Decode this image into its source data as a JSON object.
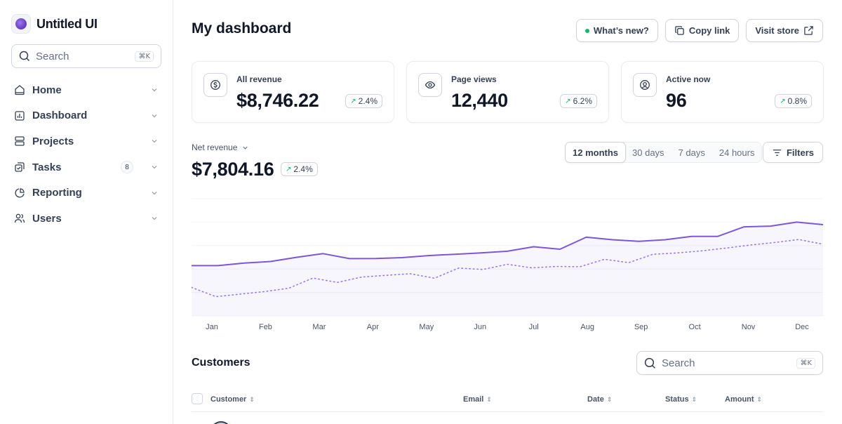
{
  "brand": {
    "name": "Untitled UI"
  },
  "sidebar": {
    "search": {
      "placeholder": "Search",
      "shortcut": "⌘K"
    },
    "items": [
      {
        "label": "Home",
        "icon": "home-icon"
      },
      {
        "label": "Dashboard",
        "icon": "bar-chart-icon"
      },
      {
        "label": "Projects",
        "icon": "layers-icon"
      },
      {
        "label": "Tasks",
        "icon": "check-square-icon",
        "badge": "8"
      },
      {
        "label": "Reporting",
        "icon": "pie-chart-icon"
      },
      {
        "label": "Users",
        "icon": "users-icon"
      }
    ]
  },
  "header": {
    "title": "My dashboard",
    "whats_new": "What’s new?",
    "copy_link": "Copy link",
    "visit_store": "Visit store"
  },
  "stats": [
    {
      "label": "All revenue",
      "value": "$8,746.22",
      "trend": "2.4%",
      "icon": "dollar-circle-icon"
    },
    {
      "label": "Page views",
      "value": "12,440",
      "trend": "6.2%",
      "icon": "eye-icon"
    },
    {
      "label": "Active now",
      "value": "96",
      "trend": "0.8%",
      "icon": "user-circle-icon"
    }
  ],
  "net_revenue": {
    "label": "Net revenue",
    "value": "$7,804.16",
    "trend": "2.4%"
  },
  "time_ranges": [
    "12 months",
    "30 days",
    "7 days",
    "24 hours"
  ],
  "selected_range": "12 months",
  "filters_label": "Filters",
  "chart_data": {
    "type": "line",
    "categories": [
      "Jan",
      "Feb",
      "Mar",
      "Apr",
      "May",
      "Jun",
      "Jul",
      "Aug",
      "Sep",
      "Oct",
      "Nov",
      "Dec"
    ],
    "series": [
      {
        "style": "solid",
        "values": [
          30,
          30,
          31.5,
          32.5,
          35,
          37.2,
          34.2,
          34.3,
          34.8,
          36,
          36.8,
          37.6,
          38.6,
          41.3,
          39.8,
          47,
          45.5,
          44.5,
          45.5,
          47.5,
          47.5,
          53.2,
          53.6,
          56,
          54.5
        ]
      },
      {
        "style": "dotted",
        "values": [
          17,
          11.5,
          13,
          14.5,
          16.5,
          22.6,
          20,
          23.2,
          24.2,
          25.2,
          22.5,
          28.6,
          27.7,
          30.8,
          28.7,
          29.5,
          29.4,
          33.8,
          31.8,
          36.8,
          37.6,
          38.8,
          40.5,
          42.3,
          43.8,
          45.6,
          42.8
        ]
      }
    ],
    "ylim": [
      0,
      70
    ],
    "grid": true,
    "color": "#7f56d9"
  },
  "customers": {
    "title": "Customers",
    "search": {
      "placeholder": "Search",
      "shortcut": "⌘K"
    },
    "columns": [
      "Customer",
      "Email",
      "Date",
      "Status",
      "Amount"
    ]
  }
}
